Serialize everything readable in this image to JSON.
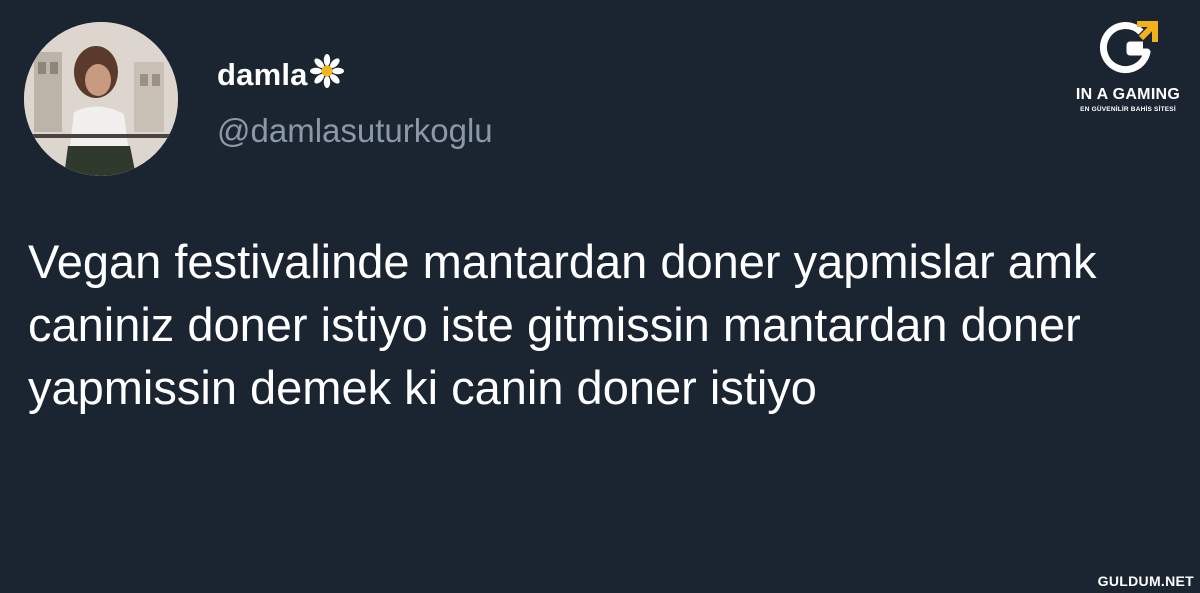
{
  "tweet": {
    "user_name": "damla",
    "handle": "@damlasuturkoglu",
    "text": "Vegan festivalinde mantardan doner yapmislar amk caniniz doner istiyo iste gitmissin mantardan doner yapmissin demek ki canin doner istiyo"
  },
  "brand": {
    "name": "IN A GAMING",
    "tagline": "EN GÜVENİLİR BAHİS SİTESİ"
  },
  "watermark": "GULDUM.NET",
  "icons": {
    "name_emoji": "daisy-icon",
    "brand_logo": "g-logo-icon"
  },
  "colors": {
    "background": "#1b2532",
    "handle": "#8b98a5",
    "brand_accent": "#f3b21c"
  }
}
